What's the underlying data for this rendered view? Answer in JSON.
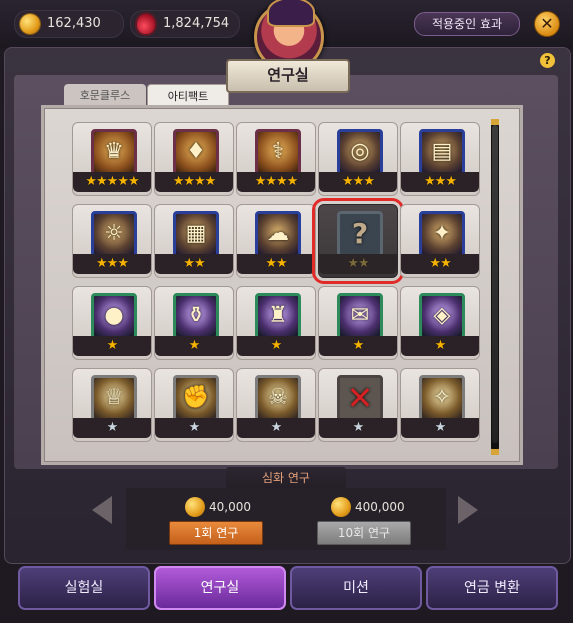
{
  "currencies": [
    {
      "icon": "gold-coin-icon",
      "value": "162,430"
    },
    {
      "icon": "red-potion-icon",
      "value": "1,824,754"
    }
  ],
  "header": {
    "effect_button": "적용중인 효과",
    "close_symbol": "✕",
    "title": "연구실",
    "help_symbol": "?"
  },
  "tabs": [
    {
      "label": "호문클루스",
      "active": false
    },
    {
      "label": "아티팩트",
      "active": true
    }
  ],
  "artifact_grid": [
    {
      "icon": "golden-mask-icon",
      "stars": "★★★★★",
      "tier": "pink"
    },
    {
      "icon": "jewel-pendant-icon",
      "stars": "★★★★",
      "tier": "pink"
    },
    {
      "icon": "caduceus-icon",
      "stars": "★★★★",
      "tier": "pink"
    },
    {
      "icon": "bronze-medallion-icon",
      "stars": "★★★",
      "tier": "blue"
    },
    {
      "icon": "treasure-chest-icon",
      "stars": "★★★",
      "tier": "blue"
    },
    {
      "icon": "gear-crown-icon",
      "stars": "★★★",
      "tier": "blue"
    },
    {
      "icon": "spellbook-icon",
      "stars": "★★",
      "tier": "blue"
    },
    {
      "icon": "ghost-icon",
      "stars": "★★",
      "tier": "blue"
    },
    {
      "icon": "unknown-question-icon",
      "stars": "★★",
      "tier": "locked",
      "glyph": "?"
    },
    {
      "icon": "sparkle-weapon-icon",
      "stars": "★★",
      "tier": "blue"
    },
    {
      "icon": "purple-orb-icon",
      "stars": "★",
      "tier": "green"
    },
    {
      "icon": "potion-flask-icon",
      "stars": "★",
      "tier": "green"
    },
    {
      "icon": "golden-armor-icon",
      "stars": "★",
      "tier": "green"
    },
    {
      "icon": "scroll-icon",
      "stars": "★",
      "tier": "green"
    },
    {
      "icon": "stone-tablet-icon",
      "stars": "★",
      "tier": "green"
    },
    {
      "icon": "golden-crown-icon",
      "stars": "★",
      "tier": "grey"
    },
    {
      "icon": "golden-fist-icon",
      "stars": "★",
      "tier": "grey"
    },
    {
      "icon": "skull-bomb-icon",
      "stars": "★",
      "tier": "grey"
    },
    {
      "icon": "red-x-icon",
      "stars": "★",
      "tier": "empty",
      "glyph": "✕"
    },
    {
      "icon": "magic-claw-icon",
      "stars": "★",
      "tier": "grey"
    }
  ],
  "research": {
    "section_title": "심화 연구",
    "single": {
      "cost": "40,000",
      "label": "1회 연구"
    },
    "ten": {
      "cost": "400,000",
      "label": "10회 연구"
    }
  },
  "nav": [
    {
      "label": "실험실",
      "active": false
    },
    {
      "label": "연구실",
      "active": true
    },
    {
      "label": "미션",
      "active": false
    },
    {
      "label": "연금 변환",
      "active": false
    }
  ]
}
